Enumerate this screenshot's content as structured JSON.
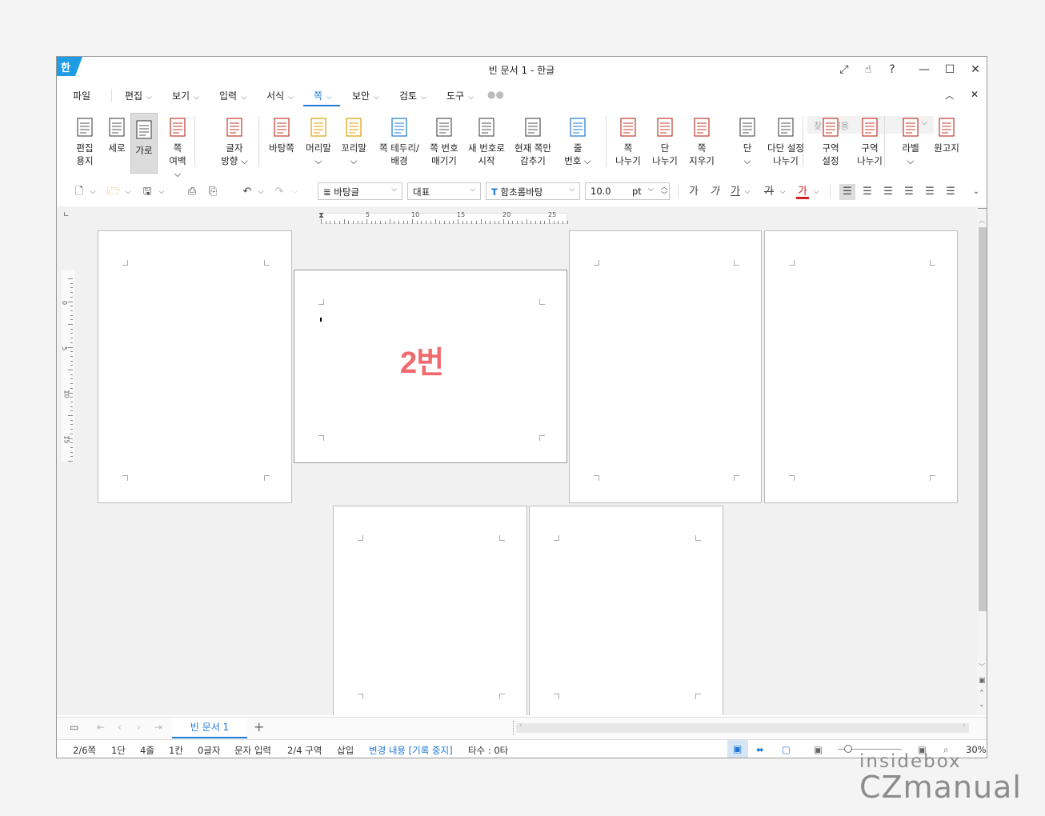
{
  "window": {
    "title": "빈 문서 1 - 한글",
    "app_icon": "한"
  },
  "menus": [
    {
      "label": "파일",
      "chevron": false
    },
    {
      "label": "편집",
      "chevron": true
    },
    {
      "label": "보기",
      "chevron": true
    },
    {
      "label": "입력",
      "chevron": true
    },
    {
      "label": "서식",
      "chevron": true
    },
    {
      "label": "쪽",
      "chevron": true,
      "active": true
    },
    {
      "label": "보안",
      "chevron": true
    },
    {
      "label": "검토",
      "chevron": true
    },
    {
      "label": "도구",
      "chevron": true
    }
  ],
  "search": {
    "placeholder": "찾을 내용"
  },
  "ribbon": [
    {
      "label": "편집\n용지",
      "icon": "page-setup-icon"
    },
    {
      "label": "세로",
      "icon": "portrait-icon"
    },
    {
      "label": "가로",
      "icon": "landscape-icon",
      "selected": true
    },
    {
      "label": "쪽\n여백 ⌵",
      "icon": "page-margin-icon"
    },
    {
      "label": "글자\n방향 ⌵",
      "icon": "text-direction-icon"
    },
    {
      "label": "바탕쪽",
      "icon": "master-page-icon"
    },
    {
      "label": "머리말\n⌵",
      "icon": "header-icon"
    },
    {
      "label": "꼬리말\n⌵",
      "icon": "footer-icon"
    },
    {
      "label": "쪽 테두리/\n배경",
      "icon": "page-border-icon"
    },
    {
      "label": "쪽 번호\n매기기",
      "icon": "page-number-icon"
    },
    {
      "label": "새 번호로\n시작",
      "icon": "new-number-icon"
    },
    {
      "label": "현재 쪽만\n감추기",
      "icon": "hide-page-icon"
    },
    {
      "label": "줄\n번호 ⌵",
      "icon": "line-number-icon"
    },
    {
      "label": "쪽\n나누기",
      "icon": "page-break-icon"
    },
    {
      "label": "단\n나누기",
      "icon": "column-break-icon"
    },
    {
      "label": "쪽\n지우기",
      "icon": "delete-page-icon"
    },
    {
      "label": "단\n⌵",
      "icon": "columns-icon"
    },
    {
      "label": "다단 설정\n나누기",
      "icon": "multi-column-icon"
    },
    {
      "label": "구역\n설정",
      "icon": "section-setup-icon"
    },
    {
      "label": "구역\n나누기",
      "icon": "section-break-icon"
    },
    {
      "label": "라벨\n⌵",
      "icon": "label-icon"
    },
    {
      "label": "원고지",
      "icon": "manuscript-icon"
    }
  ],
  "toolbar": {
    "style": "바탕글",
    "language": "대표",
    "font": "함초롬바탕",
    "size": "10.0",
    "unit": "pt",
    "bold": "가",
    "italic": "가",
    "underline": "가",
    "strike": "가",
    "color": "가"
  },
  "ruler": {
    "marks": [
      "5",
      "10",
      "15",
      "20",
      "25"
    ]
  },
  "vruler": {
    "marks": [
      "0",
      "5",
      "10",
      "15"
    ]
  },
  "annotation": "2번",
  "tabs": {
    "active": "빈 문서 1",
    "add": "+"
  },
  "status": {
    "page": "2/6쪽",
    "column": "1단",
    "line": "4줄",
    "col": "1칸",
    "chars": "0글자",
    "mode": "문자 입력",
    "section": "2/4 구역",
    "insert": "삽입",
    "track": "변경 내용 [기록 중지]",
    "typing": "타수 : 0타",
    "zoom": "30%"
  },
  "watermark": {
    "line1": "insidebox",
    "line2": "CZmanual"
  },
  "colors": {
    "accent": "#1e78d6",
    "annotation": "#f06a6e",
    "app_icon": "#1e9ce6"
  }
}
